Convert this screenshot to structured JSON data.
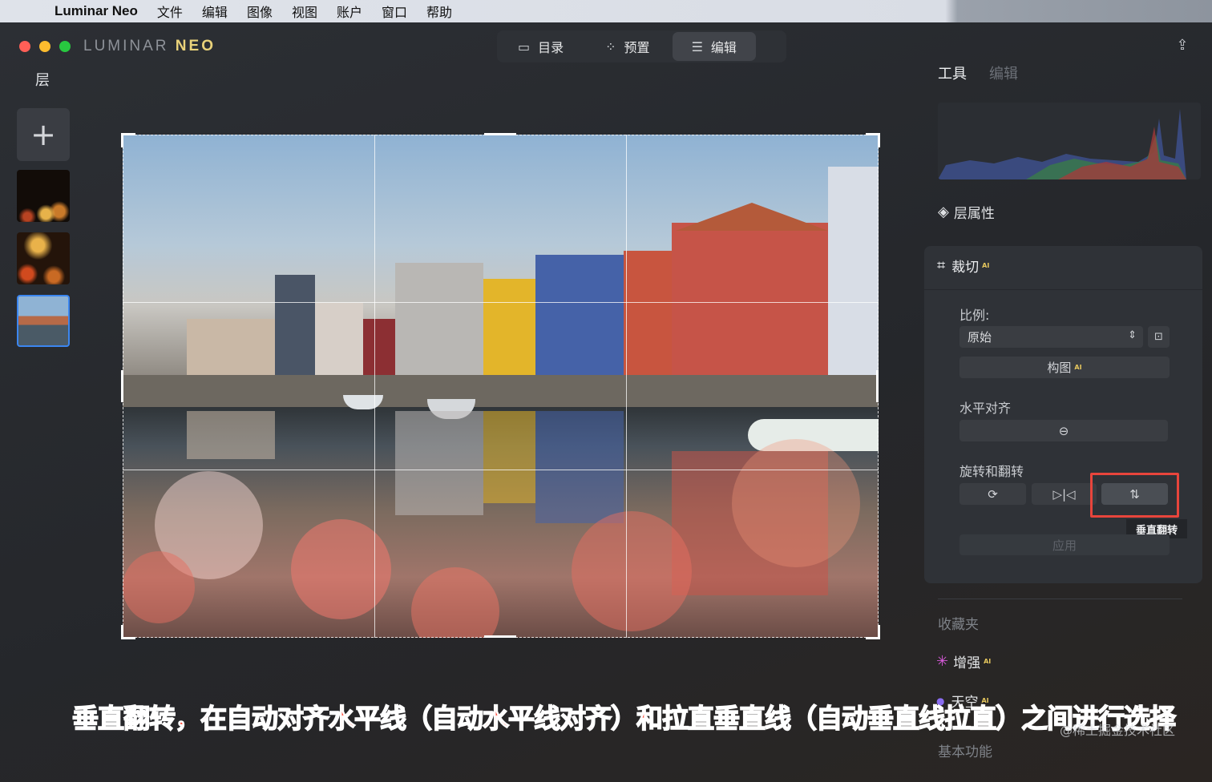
{
  "menubar": {
    "app_name": "Luminar Neo",
    "items": [
      "文件",
      "编辑",
      "图像",
      "视图",
      "账户",
      "窗口",
      "帮助"
    ]
  },
  "window": {
    "logo_left": "LUMINAR ",
    "logo_right": "NEO",
    "modes": [
      {
        "label": "目录",
        "icon": "folder-icon"
      },
      {
        "label": "预置",
        "icon": "sparkle-icon"
      },
      {
        "label": "编辑",
        "icon": "sliders-icon",
        "active": true
      }
    ]
  },
  "layers": {
    "title": "层",
    "add_symbol": "+"
  },
  "right_panel": {
    "tab_tools": "工具",
    "tab_edit": "编辑",
    "layer_properties": "层属性",
    "crop": {
      "title": "裁切",
      "ai_badge": "AI",
      "ratio_label": "比例:",
      "ratio_value": "原始",
      "compose_button": "构图",
      "compose_ai": "AI",
      "horizon_label": "水平对齐",
      "rotate_flip_label": "旋转和翻转",
      "tooltip": "垂直翻转",
      "apply_button": "应用"
    },
    "favorites": "收藏夹",
    "enhance": "增强",
    "enhance_ai": "AI",
    "sky": "天空",
    "sky_ai": "AI",
    "basic": "基本功能"
  },
  "annotation": {
    "caption": "垂直翻转，在自动对齐水平线（自动水平线对齐）和拉直垂直线（自动垂直线拉直）之间进行选择",
    "watermark": "@稀土掘金技术社区"
  },
  "colors": {
    "highlight": "#e8453c",
    "accent": "#3b86f0",
    "ai_badge": "#e7c85e"
  }
}
